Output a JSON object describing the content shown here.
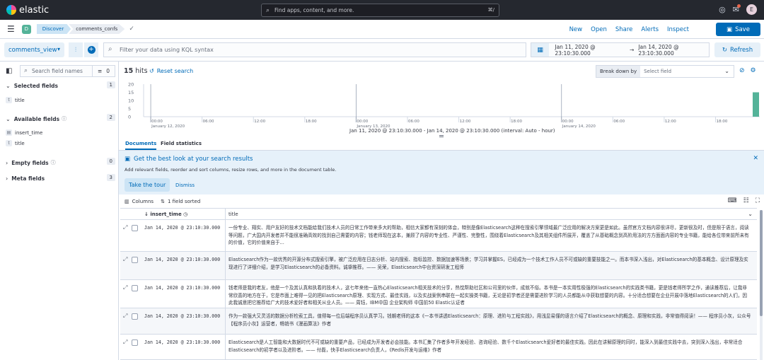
{
  "app": {
    "name": "elastic",
    "search_placeholder": "Find apps, content, and more.",
    "search_shortcut": "⌘/",
    "avatar_letter": "E"
  },
  "nav": {
    "space_letter": "D",
    "breadcrumb": [
      "Discover",
      "comments_confs"
    ],
    "links": [
      "New",
      "Open",
      "Share",
      "Alerts",
      "Inspect"
    ],
    "save_label": "Save"
  },
  "query": {
    "index_pattern": "comments_view",
    "kql_placeholder": "Filter your data using KQL syntax",
    "date_start": "Jan 11, 2020 @ 23:10:30.000",
    "date_arrow": "→",
    "date_end": "Jan 14, 2020 @ 23:10:30.000",
    "refresh_label": "Refresh"
  },
  "sidebar": {
    "search_placeholder": "Search field names",
    "filter_count": "0",
    "sections": {
      "selected": {
        "label": "Selected fields",
        "count": "1",
        "fields": [
          {
            "type": "t",
            "name": "title"
          }
        ]
      },
      "available": {
        "label": "Available fields",
        "count": "2",
        "fields": [
          {
            "type": "date",
            "name": "insert_time"
          },
          {
            "type": "t",
            "name": "title"
          }
        ]
      },
      "empty": {
        "label": "Empty fields",
        "count": "0"
      },
      "meta": {
        "label": "Meta fields",
        "count": "3"
      }
    }
  },
  "main": {
    "hits_count": "15",
    "hits_label": "hits",
    "reset_label": "Reset search",
    "breakdown_label": "Break down by",
    "breakdown_placeholder": "Select field",
    "interval_text": "Jan 11, 2020 @ 23:10:30.000 - Jan 14, 2020 @ 23:10:30.000 (interval: Auto - hour)",
    "tabs": [
      "Documents",
      "Field statistics"
    ],
    "callout": {
      "title": "Get the best look at your search results",
      "text": "Add relevant fields, reorder and sort columns, resize rows, and more in the document table.",
      "tour_label": "Take the tour",
      "dismiss_label": "Dismiss"
    },
    "grid": {
      "columns_label": "Columns",
      "sorted_label": "1 field sorted",
      "col_time": "insert_time",
      "col_title": "title"
    }
  },
  "chart_data": {
    "type": "bar",
    "y_ticks": [
      "20",
      "15",
      "10",
      "5",
      "0"
    ],
    "ylim": [
      0,
      20
    ],
    "x_tick_labels": [
      "00:00",
      "06:00",
      "12:00",
      "18:00",
      "00:00",
      "06:00",
      "12:00",
      "18:00",
      "00:00",
      "06:00",
      "12:00",
      "18:00",
      "00:00",
      "06:00",
      "12:00",
      "18:00"
    ],
    "x_day_labels": [
      "January 12, 2020",
      "January 13, 2020",
      "January 14, 2020"
    ],
    "bars": [
      {
        "x": "Jan 14, 2020 @ 23:00",
        "value": 15
      }
    ]
  },
  "rows": [
    {
      "time": "Jan 14, 2020 @ 23:10:30.000",
      "title": "一份专业、翔实、用户友好的技术文档能给我们技术人员的日常工作带来多大的帮助，相信大家都有深刻的体会，特别是像Elasticsearch这种在搜索引擎领域最广泛应用的解决方案更是如此。虽然官方文档内容很详尽，更新很及时，但是限于语言，阅读等问题，广大国内开发者并不能很准确高效的找到自己需要的内容；钱老师现在这本，兼顾了内容的专业性、严谨性、完整性，围绕着Elasticsearch及其相关组件所展开，覆盖了从基础概念到高阶用法的方方面面内容的专业书籍，能给各位带来前所未有的价值，它的价值来自于..."
    },
    {
      "time": "Jan 14, 2020 @ 23:10:30.000",
      "title": "Elasticsearch作为一款优秀的开源分布式搜索引擎，被广泛应用在日志分析、站内搜索、指标监控、数据加速等场景；学习并掌握ES，已经成为一个技术工作人员不可或缺的重要技能之一。而本书深入浅出，对Elasticsearch的基本概念、设计原理及实现进行了详细介绍，是学习Elasticsearch的必备资料。诚挚推荐。—— 吴荣，Elasticsearch中台资深研发工程师"
    },
    {
      "time": "Jan 14, 2020 @ 23:10:30.000",
      "title": "钱老师是我的老友，他是一个及其认真和执着的技术人，这七年来他一直热心Elasticsearch相关技术的分享，热忱帮助社区和公司里的伙伴，成就不俗。本书是一本实用性极强的Elasticsearch的实践类书籍，更是钱老师所学之作，通读推荐后，让我非常欣喜的地方在于，它是市面上难得一见的把Elasticsearch原理、实现方式、最佳实践，以及实战案例串联在一起实操类书籍，无论是初学者还是需要进阶学习的人员都能从中获取想要的内容。十分适合想要在企业开展中落地Elasticsearch的人们，因此我诚意把它推荐给广大的技术爱好者和相关从业人员。—— 周钰，IBM中国 企业架构师 中国前50 Elastic认证者"
    },
    {
      "time": "Jan 14, 2020 @ 23:10:30.000",
      "title": "作为一款强大又灵活的数据分析检索工具，值得每一位后端程序员认真学习。钱朝老师的这本《一本书讲透Elasticsearch：原理、进阶与工程实践》，用浅显易懂的语言介绍了Elasticsearch的概念、原理和实践，非常值得阅读！—— 程序员小灰，公众号【程序员小灰】运营者，畅销书《漫画算法》作者"
    },
    {
      "time": "Jan 14, 2020 @ 23:10:30.000",
      "title": "Elasticsearch是人工智能和大数据时代不可或缺的重要产品，已经成为开发者必会技能。本书汇集了作者多年开发经验、咨询经验、数千个Elasticsearch爱好者的最佳实践。因此在讲解原理的同时，能深入到最佳实践中去，突到深入浅出，非常适合Elasticsearch的初学者以及进阶者。—— 付磊，快手Elasticsearch负责人，《Redis开发与运维》作者"
    }
  ]
}
